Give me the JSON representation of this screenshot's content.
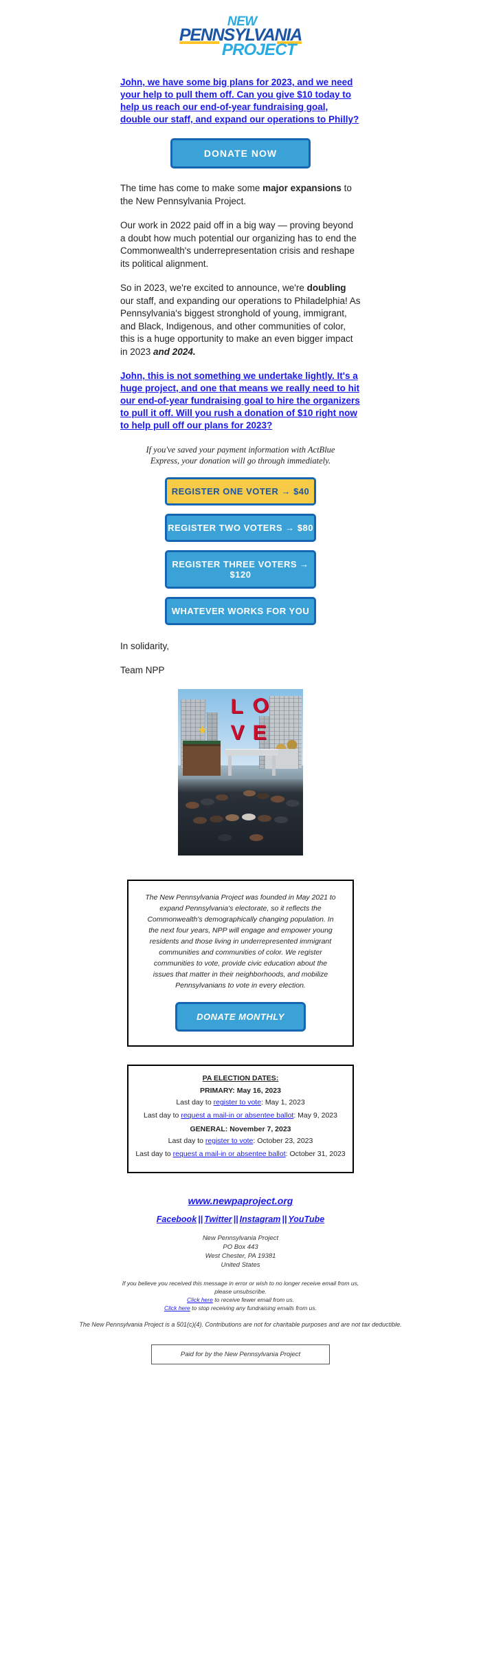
{
  "brand": {
    "logo_line1": "NEW",
    "logo_line2": "PENNSYLVANIA",
    "logo_line3": "PROJECT",
    "color_light_blue": "#29ABE2",
    "color_dark_blue": "#1B55A5",
    "color_gold": "#FFC425",
    "color_link": "#1A1AEA",
    "color_button_blue": "#3BA2D8",
    "color_button_border": "#1466B3"
  },
  "intro": {
    "link_paragraph": "John, we have some big plans for 2023, and we need your help to pull them off. Can you give $10 today to help us reach our end-of-year fundraising goal, double our staff, and expand our operations to Philly?",
    "donate_button": "DONATE NOW"
  },
  "body": {
    "p1_a": "The time has come to make some ",
    "p1_b": "major expansions",
    "p1_c": " to the New Pennsylvania Project.",
    "p2": "Our work in 2022 paid off in a big way — proving beyond a doubt how much potential our organizing has to end the Commonwealth's underrepresentation crisis and reshape its political alignment.",
    "p3_a": "So in 2023, we're excited to announce, we're ",
    "p3_b": "doubling",
    "p3_c": " our staff, and expanding our operations to Philadelphia! As Pennsylvania's biggest stronghold of young, immigrant, and Black, Indigenous, and other communities of color, this is a huge opportunity to make an even bigger impact in 2023 ",
    "p3_d": "and 2024.",
    "link_paragraph2": "John, this is not something we undertake lightly. It's a huge project, and one that means we really need to hit our end-of-year fundraising goal to hire the organizers to pull it off. Will you rush a donation of $10 right now to help pull off our plans for 2023?"
  },
  "actblue_note": "If you've saved your payment information with ActBlue Express, your donation will go through immediately.",
  "ask_buttons": [
    {
      "label": "REGISTER ONE VOTER → $40",
      "style": "gold"
    },
    {
      "label": "REGISTER TWO VOTERS → $80",
      "style": "blue"
    },
    {
      "label": "REGISTER THREE VOTERS → $120",
      "style": "blue"
    },
    {
      "label": "WHATEVER WORKS FOR YOU",
      "style": "blue"
    }
  ],
  "signoff": {
    "line1": "In solidarity,",
    "line2": "Team NPP"
  },
  "photo_alt": "NPP team group photo at the LOVE sculpture in Philadelphia",
  "mission": {
    "text": "The New Pennsylvania Project was founded in May 2021 to expand Pennsylvania's electorate, so it reflects the Commonwealth's demographically changing population. In the next four years, NPP will engage and empower young residents and those living in underrepresented immigrant communities and communities of color. We register communities to vote, provide civic education about the issues that matter in their neighborhoods, and mobilize Pennsylvanians to vote in every election.",
    "button": "DONATE MONTHLY"
  },
  "election": {
    "title": "PA ELECTION DATES:",
    "primary_head": "PRIMARY: May 16, 2023",
    "primary_register_pre": "Last day to ",
    "primary_register_link": "register to vote",
    "primary_register_post": ": May 1, 2023",
    "primary_mail_pre": "Last day to ",
    "primary_mail_link": "request a mail-in or absentee ballot",
    "primary_mail_post": ": May 9, 2023",
    "general_head": "GENERAL: November 7, 2023",
    "general_register_pre": "Last day to ",
    "general_register_link": "register to vote",
    "general_register_post": ": October 23, 2023",
    "general_mail_pre": "Last day to ",
    "general_mail_link": "request a mail-in or absentee ballot",
    "general_mail_post": ": October 31, 2023"
  },
  "footer": {
    "website": "www.newpaproject.org",
    "social": [
      {
        "label": "Facebook"
      },
      {
        "label": "Twitter"
      },
      {
        "label": "Instagram"
      },
      {
        "label": "YouTube"
      }
    ],
    "social_separator": "||",
    "address_line1": "New Pennsylvania Project",
    "address_line2": "PO Box 443",
    "address_line3": "West Chester, PA 19381",
    "address_line4": "United States",
    "fine_line1": "If you believe you received this message in error or wish to no longer receive email from us,",
    "fine_line2": "please unsubscribe.",
    "fine_line3_link": "Click here",
    "fine_line3_rest": " to receive fewer email from us.",
    "fine_line4_link": "Click here",
    "fine_line4_rest": " to stop receiving any fundraising emails from us.",
    "disclaimer": "The New Pennsylvania Project is a 501(c)(4). Contributions are not for charitable purposes and are not tax deductible.",
    "paid_for": "Paid for by the New Pennsylvania Project"
  }
}
